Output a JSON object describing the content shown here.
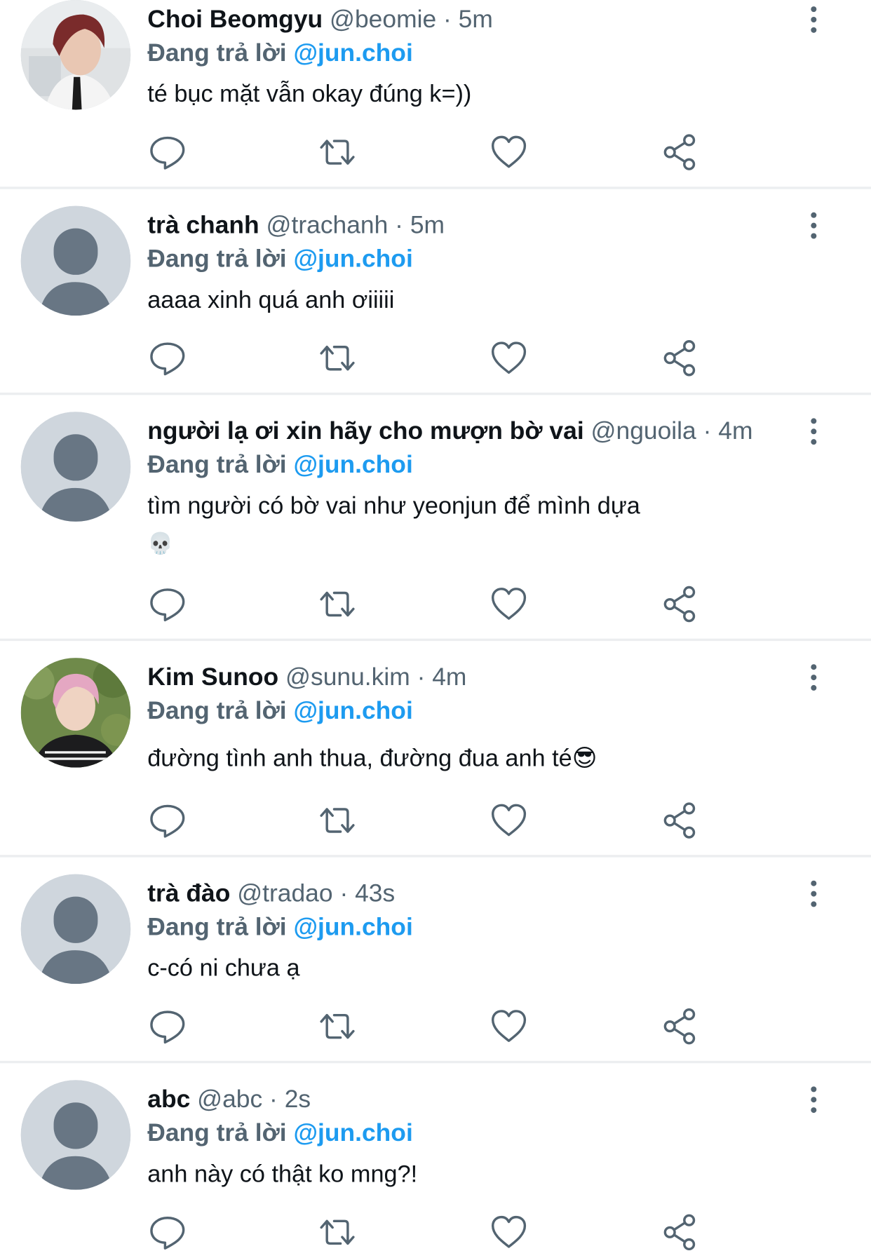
{
  "reply_label": "Đang trả lời",
  "tweets": [
    {
      "name": "Choi Beomgyu",
      "handle": "@beomie",
      "sep": "·",
      "time": "5m",
      "reply_to": "@jun.choi",
      "text": "té bục mặt vẫn okay đúng k=))",
      "text2": "",
      "avatar": "photo-boy-dark-hair"
    },
    {
      "name": "trà chanh",
      "handle": "@trachanh",
      "sep": "·",
      "time": "5m",
      "reply_to": "@jun.choi",
      "text": "aaaa xinh quá anh ơiiiii",
      "text2": "",
      "avatar": "default-avatar"
    },
    {
      "name": "người lạ ơi xin hãy cho mượn bờ vai",
      "handle": "@nguoila",
      "sep": "·",
      "time": "4m",
      "reply_to": "@jun.choi",
      "text": "tìm người có bờ vai như yeonjun để mình dựa",
      "text2": "💀",
      "avatar": "default-avatar"
    },
    {
      "name": "Kim Sunoo",
      "handle": "@sunu.kim",
      "sep": "·",
      "time": "4m",
      "reply_to": "@jun.choi",
      "text": "đường tình anh thua, đường đua anh té😎",
      "text2": "",
      "avatar": "photo-boy-pink-hair"
    },
    {
      "name": "trà đào",
      "handle": "@tradao",
      "sep": "·",
      "time": "43s",
      "reply_to": "@jun.choi",
      "text": "c-có ni chưa ạ",
      "text2": "",
      "avatar": "default-avatar"
    },
    {
      "name": "abc",
      "handle": "@abc",
      "sep": "·",
      "time": "2s",
      "reply_to": "@jun.choi",
      "text": "anh này có thật ko mng?!",
      "text2": "",
      "avatar": "default-avatar"
    }
  ],
  "icons": {
    "reply": "reply-icon",
    "retweet": "retweet-icon",
    "like": "heart-icon",
    "share": "share-icon",
    "more": "more-vertical-icon"
  },
  "colors": {
    "mention": "#1d9bf0",
    "muted": "#536471",
    "divider": "#eceef0",
    "default_avatar_bg": "#cfd6dd",
    "default_avatar_fg": "#687684"
  }
}
